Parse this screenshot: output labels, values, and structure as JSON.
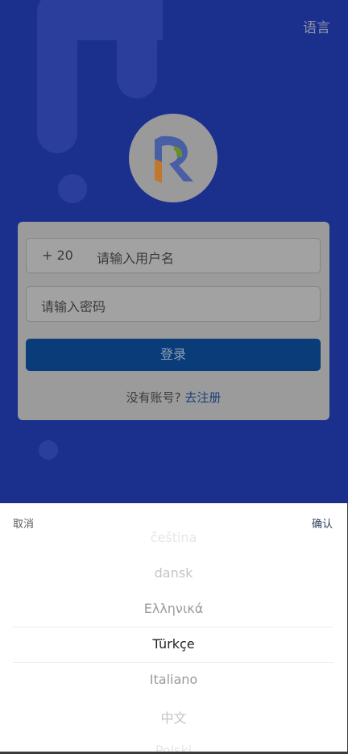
{
  "header": {
    "language_label": "语言"
  },
  "login": {
    "country_code": "+ 20",
    "username_placeholder": "请输入用户名",
    "password_placeholder": "请输入密码",
    "login_button": "登录",
    "no_account_text": "没有账号?",
    "register_link": "去注册"
  },
  "language_picker": {
    "cancel_label": "取消",
    "confirm_label": "确认",
    "options": [
      "čeština",
      "dansk",
      "Ελληνικά",
      "Türkçe",
      "Italiano",
      "中文",
      "Polski"
    ],
    "selected": "Türkçe"
  },
  "colors": {
    "background": "#1b2f8d",
    "card": "#9b9b9b",
    "primary_button": "#093c79",
    "link": "#1a3f7a"
  }
}
